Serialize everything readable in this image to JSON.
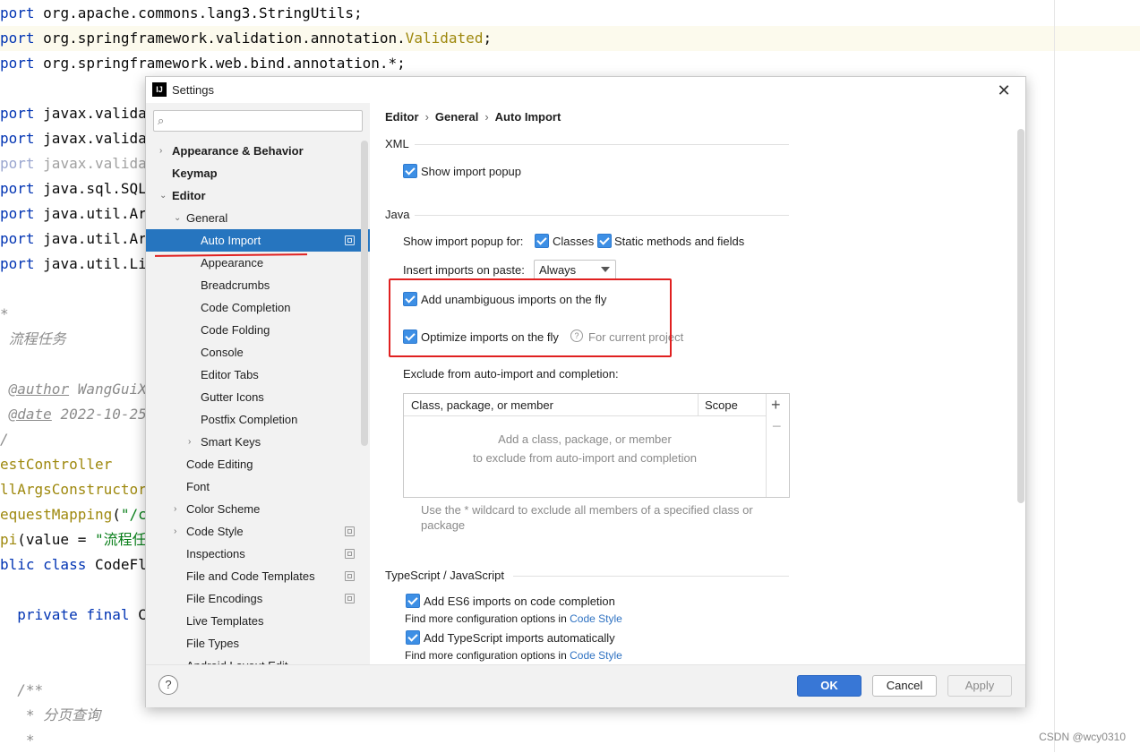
{
  "editor": {
    "lines": [
      {
        "parts": [
          {
            "t": "port ",
            "c": "kw"
          },
          {
            "t": "org.apache.commons.lang3.StringUtils;"
          }
        ]
      },
      {
        "parts": [
          {
            "t": "port ",
            "c": "kw"
          },
          {
            "t": "org.springframework.validation.annotation."
          },
          {
            "t": "Validated",
            "c": "anno"
          },
          {
            "t": ";"
          }
        ]
      },
      {
        "parts": [
          {
            "t": "port ",
            "c": "kw"
          },
          {
            "t": "org.springframework.web.bind.annotation.*;"
          }
        ]
      },
      {
        "parts": []
      },
      {
        "parts": [
          {
            "t": "port ",
            "c": "kw"
          },
          {
            "t": "javax.valida"
          }
        ]
      },
      {
        "parts": [
          {
            "t": "port ",
            "c": "kw"
          },
          {
            "t": "javax.valida"
          }
        ]
      },
      {
        "dim": true,
        "parts": [
          {
            "t": "port ",
            "c": "kw"
          },
          {
            "t": "javax.valida"
          }
        ]
      },
      {
        "parts": [
          {
            "t": "port ",
            "c": "kw"
          },
          {
            "t": "java.sql.SQL"
          }
        ]
      },
      {
        "parts": [
          {
            "t": "port ",
            "c": "kw"
          },
          {
            "t": "java.util.Ar"
          }
        ]
      },
      {
        "parts": [
          {
            "t": "port ",
            "c": "kw"
          },
          {
            "t": "java.util.Ar"
          }
        ]
      },
      {
        "parts": [
          {
            "t": "port ",
            "c": "kw"
          },
          {
            "t": "java.util.Li"
          }
        ]
      },
      {
        "parts": []
      },
      {
        "parts": [
          {
            "t": "*",
            "c": "cm"
          }
        ]
      },
      {
        "parts": [
          {
            "t": " 流程任务",
            "c": "cm"
          }
        ]
      },
      {
        "parts": []
      },
      {
        "parts": [
          {
            "t": " ",
            "c": "cm"
          },
          {
            "t": "@author",
            "c": "tag"
          },
          {
            "t": " WangGuiX",
            "c": "cm"
          }
        ]
      },
      {
        "parts": [
          {
            "t": " ",
            "c": "cm"
          },
          {
            "t": "@date",
            "c": "tag"
          },
          {
            "t": " 2022-10-25",
            "c": "cm"
          }
        ]
      },
      {
        "parts": [
          {
            "t": "/",
            "c": "cm"
          }
        ]
      },
      {
        "parts": [
          {
            "t": "estController",
            "c": "anno"
          }
        ]
      },
      {
        "parts": [
          {
            "t": "llArgsConstructor",
            "c": "anno"
          }
        ]
      },
      {
        "parts": [
          {
            "t": "equestMapping",
            "c": "anno"
          },
          {
            "t": "("
          },
          {
            "t": "\"/c",
            "c": "str"
          }
        ]
      },
      {
        "parts": [
          {
            "t": "pi",
            "c": "anno"
          },
          {
            "t": "(value = "
          },
          {
            "t": "\"流程任",
            "c": "str"
          }
        ]
      },
      {
        "parts": [
          {
            "t": "blic class ",
            "c": "kw"
          },
          {
            "t": "CodeFl"
          }
        ]
      },
      {
        "parts": []
      },
      {
        "parts": [
          {
            "t": "  private final ",
            "c": "kw"
          },
          {
            "t": "C"
          }
        ]
      },
      {
        "parts": []
      },
      {
        "parts": []
      },
      {
        "parts": [
          {
            "t": "  /**",
            "c": "cm"
          }
        ]
      },
      {
        "parts": [
          {
            "t": "   * 分页查询",
            "c": "cm"
          }
        ]
      },
      {
        "parts": [
          {
            "t": "   *",
            "c": "cm"
          }
        ]
      }
    ]
  },
  "watermark": "CSDN @wcy0310",
  "dialog": {
    "title": "Settings",
    "close_glyph": "✕",
    "app_icon_text": "IJ",
    "search": {
      "placeholder": "",
      "value": "",
      "icon_glyph": "⌕"
    },
    "tree": [
      {
        "label": "Appearance & Behavior",
        "indent": 0,
        "arrow": "›",
        "bold": true
      },
      {
        "label": "Keymap",
        "indent": 0,
        "arrow": "",
        "bold": true
      },
      {
        "label": "Editor",
        "indent": 0,
        "arrow": "⌄",
        "bold": true
      },
      {
        "label": "General",
        "indent": 1,
        "arrow": "⌄"
      },
      {
        "label": "Auto Import",
        "indent": 2,
        "arrow": "",
        "selected": true,
        "project": true
      },
      {
        "label": "Appearance",
        "indent": 2,
        "arrow": ""
      },
      {
        "label": "Breadcrumbs",
        "indent": 2,
        "arrow": ""
      },
      {
        "label": "Code Completion",
        "indent": 2,
        "arrow": ""
      },
      {
        "label": "Code Folding",
        "indent": 2,
        "arrow": ""
      },
      {
        "label": "Console",
        "indent": 2,
        "arrow": ""
      },
      {
        "label": "Editor Tabs",
        "indent": 2,
        "arrow": ""
      },
      {
        "label": "Gutter Icons",
        "indent": 2,
        "arrow": ""
      },
      {
        "label": "Postfix Completion",
        "indent": 2,
        "arrow": ""
      },
      {
        "label": "Smart Keys",
        "indent": 2,
        "arrow": "›"
      },
      {
        "label": "Code Editing",
        "indent": 1,
        "arrow": ""
      },
      {
        "label": "Font",
        "indent": 1,
        "arrow": ""
      },
      {
        "label": "Color Scheme",
        "indent": 1,
        "arrow": "›"
      },
      {
        "label": "Code Style",
        "indent": 1,
        "arrow": "›",
        "project": true
      },
      {
        "label": "Inspections",
        "indent": 1,
        "arrow": "",
        "project": true
      },
      {
        "label": "File and Code Templates",
        "indent": 1,
        "arrow": "",
        "project": true
      },
      {
        "label": "File Encodings",
        "indent": 1,
        "arrow": "",
        "project": true
      },
      {
        "label": "Live Templates",
        "indent": 1,
        "arrow": ""
      },
      {
        "label": "File Types",
        "indent": 1,
        "arrow": ""
      },
      {
        "label": "Android Layout Edit",
        "indent": 1,
        "arrow": ""
      }
    ],
    "breadcrumb": [
      "Editor",
      "General",
      "Auto Import"
    ],
    "breadcrumb_sep": "›",
    "xml": {
      "title": "XML",
      "show_popup_label": "Show import popup",
      "show_popup_checked": true
    },
    "java": {
      "title": "Java",
      "popup_for_label": "Show import popup for:",
      "classes_label": "Classes",
      "classes_checked": true,
      "static_label": "Static methods and fields",
      "static_checked": true,
      "paste_label": "Insert imports on paste:",
      "paste_value": "Always",
      "unambiguous_label": "Add unambiguous imports on the fly",
      "unambiguous_checked": true,
      "optimize_label": "Optimize imports on the fly",
      "optimize_checked": true,
      "optimize_help_glyph": "?",
      "optimize_scope": "For current project",
      "exclude_label": "Exclude from auto-import and completion:",
      "table": {
        "columns": [
          "Class, package, or member",
          "Scope"
        ],
        "add_glyph": "+",
        "remove_glyph": "−",
        "empty_line1": "Add a class, package, or member",
        "empty_line2": "to exclude from auto-import and completion"
      },
      "wildcard_hint": "Use the * wildcard to exclude all members of a specified class or package"
    },
    "ts": {
      "title": "TypeScript / JavaScript",
      "es6_label": "Add ES6 imports on code completion",
      "es6_checked": true,
      "find_more_prefix": "Find more configuration options in",
      "code_style_link": "Code Style",
      "ts_label": "Add TypeScript imports automatically",
      "ts_checked": true
    },
    "footer": {
      "help_glyph": "?",
      "ok": "OK",
      "cancel": "Cancel",
      "apply": "Apply"
    }
  }
}
